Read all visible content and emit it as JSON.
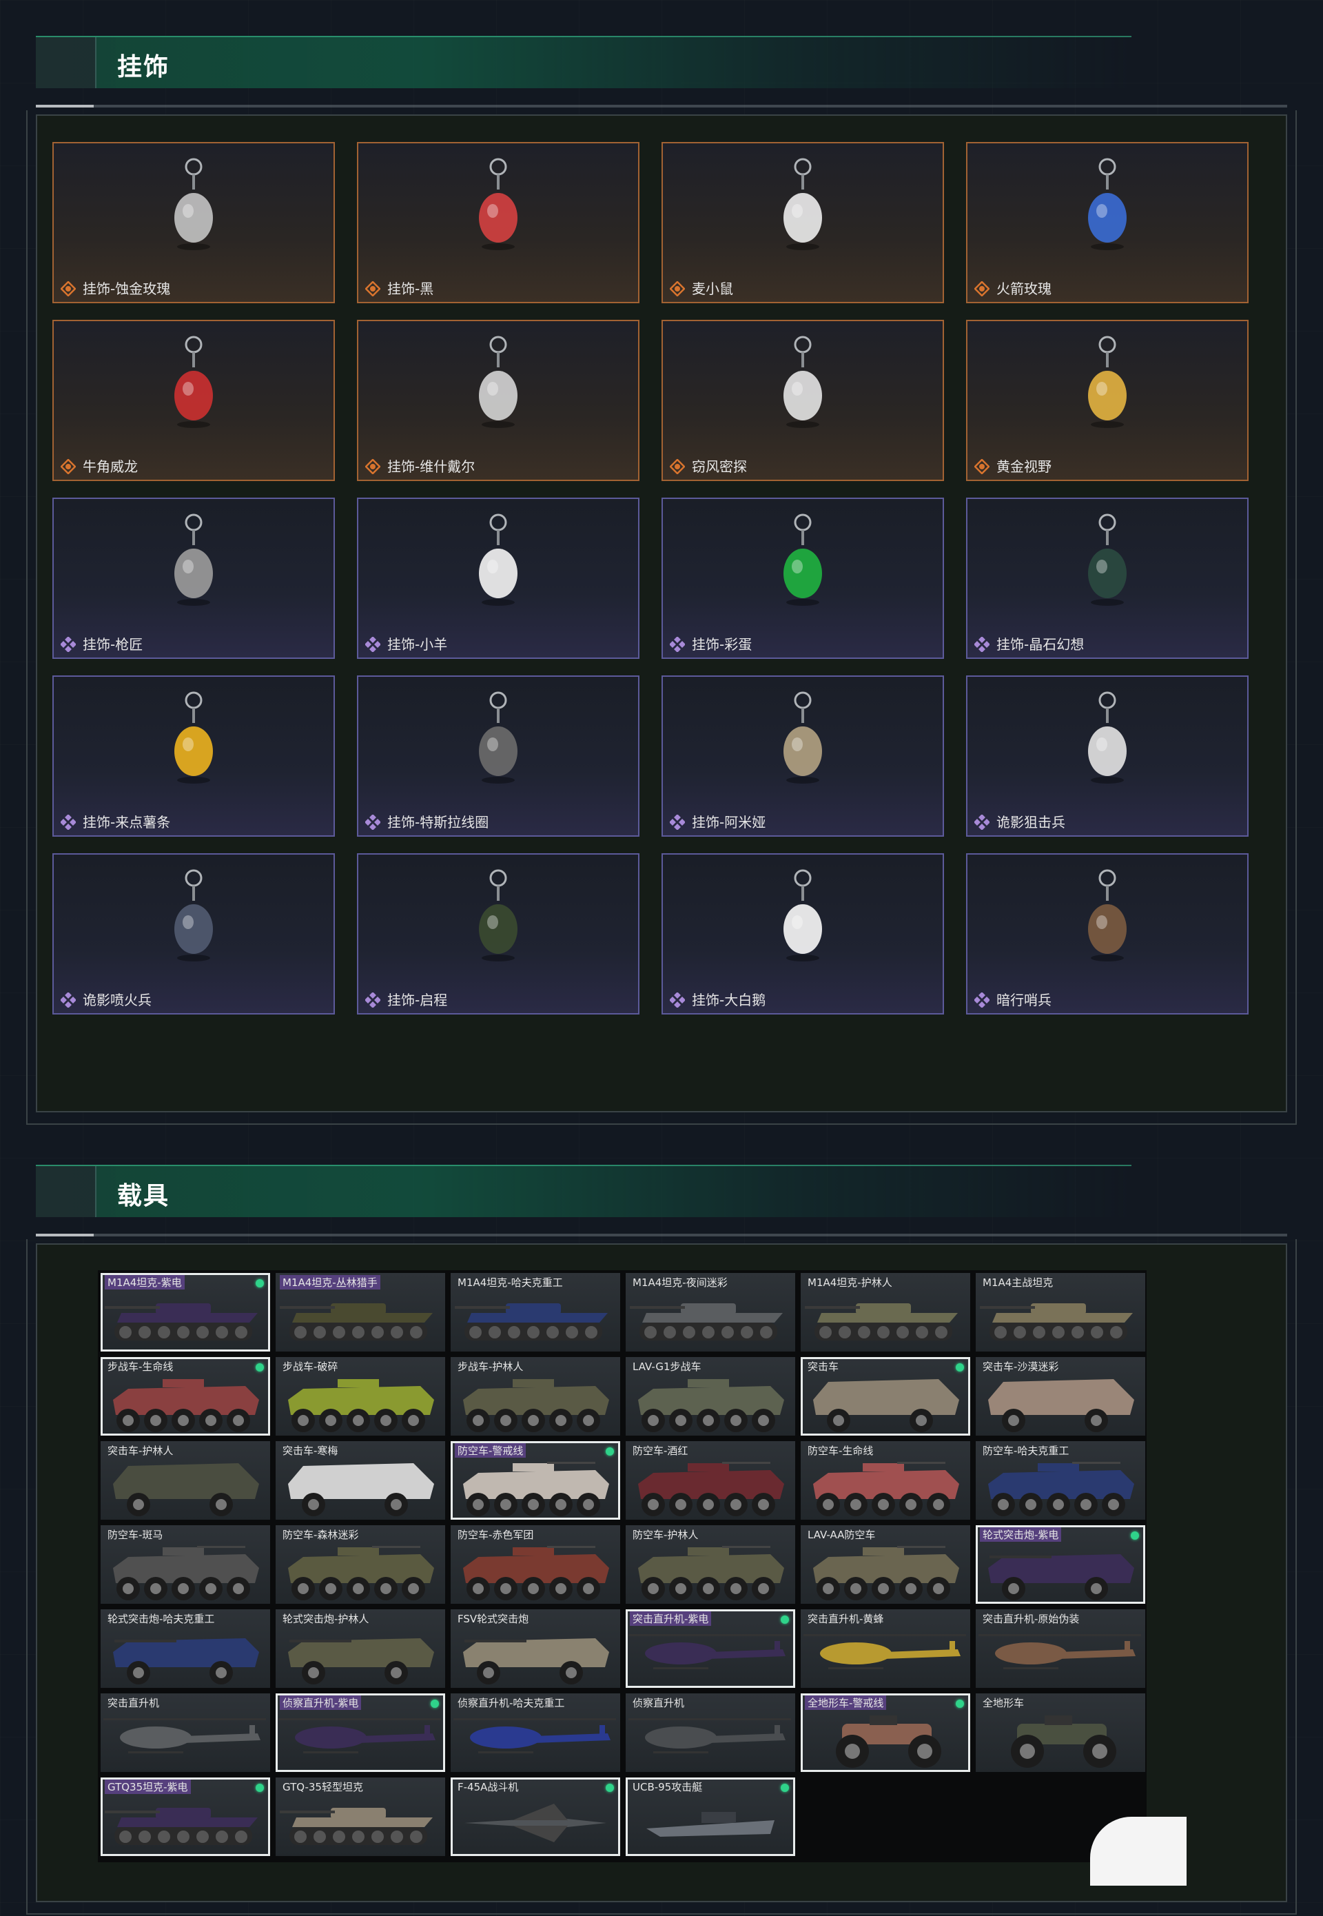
{
  "pendants_section": {
    "title": "挂饰"
  },
  "vehicles_section": {
    "title": "载具"
  },
  "colors": {
    "gold": "#d8742e",
    "purple": "#a88ad8",
    "green_dot": "#2fd38a"
  },
  "pendants": [
    {
      "name": "挂饰-蚀金玫瑰",
      "rarity": "gold",
      "icon": "gold-rose-pendant-icon"
    },
    {
      "name": "挂饰-黑",
      "rarity": "gold",
      "icon": "black-tag-pendant-icon"
    },
    {
      "name": "麦小鼠",
      "rarity": "gold",
      "icon": "mouse-pendant-icon"
    },
    {
      "name": "火箭玫瑰",
      "rarity": "gold",
      "icon": "rocket-rose-pendant-icon"
    },
    {
      "name": "牛角威龙",
      "rarity": "gold",
      "icon": "horn-dragon-pendant-icon"
    },
    {
      "name": "挂饰-维什戴尔",
      "rarity": "gold",
      "icon": "tag-pendant-icon"
    },
    {
      "name": "窃风密探",
      "rarity": "gold",
      "icon": "mouse-spy-pendant-icon"
    },
    {
      "name": "黄金视野",
      "rarity": "gold",
      "icon": "golden-vision-pendant-icon"
    },
    {
      "name": "挂饰-枪匠",
      "rarity": "purple",
      "icon": "gunsmith-pendant-icon"
    },
    {
      "name": "挂饰-小羊",
      "rarity": "purple",
      "icon": "lamb-pendant-icon"
    },
    {
      "name": "挂饰-彩蛋",
      "rarity": "purple",
      "icon": "egg-pendant-icon"
    },
    {
      "name": "挂饰-晶石幻想",
      "rarity": "purple",
      "icon": "crystal-cube-pendant-icon"
    },
    {
      "name": "挂饰-来点薯条",
      "rarity": "purple",
      "icon": "fries-pendant-icon"
    },
    {
      "name": "挂饰-特斯拉线圈",
      "rarity": "purple",
      "icon": "tesla-coil-pendant-icon"
    },
    {
      "name": "挂饰-阿米娅",
      "rarity": "purple",
      "icon": "amiya-pendant-icon"
    },
    {
      "name": "诡影狙击兵",
      "rarity": "purple",
      "icon": "sniper-pendant-icon"
    },
    {
      "name": "诡影喷火兵",
      "rarity": "purple",
      "icon": "flamer-pendant-icon"
    },
    {
      "name": "挂饰-启程",
      "rarity": "purple",
      "icon": "departure-medal-pendant-icon"
    },
    {
      "name": "挂饰-大白鹅",
      "rarity": "purple",
      "icon": "goose-pendant-icon"
    },
    {
      "name": "暗行哨兵",
      "rarity": "purple",
      "icon": "sentinel-pendant-icon"
    }
  ],
  "vehicles": [
    {
      "name": "M1A4坦克-紫电",
      "type": "tank",
      "selected": true,
      "dot": true,
      "purple": true,
      "color": "#3a2d55"
    },
    {
      "name": "M1A4坦克-丛林猎手",
      "type": "tank",
      "selected": false,
      "dot": false,
      "purple": true,
      "color": "#4a4a30"
    },
    {
      "name": "M1A4坦克-哈夫克重工",
      "type": "tank",
      "selected": false,
      "dot": false,
      "purple": false,
      "color": "#2a3a70"
    },
    {
      "name": "M1A4坦克-夜间迷彩",
      "type": "tank",
      "selected": false,
      "dot": false,
      "purple": false,
      "color": "#5a5d60"
    },
    {
      "name": "M1A4坦克-护林人",
      "type": "tank",
      "selected": false,
      "dot": false,
      "purple": false,
      "color": "#6a6a50"
    },
    {
      "name": "M1A4主战坦克",
      "type": "tank",
      "selected": false,
      "dot": false,
      "purple": false,
      "color": "#7a7258"
    },
    {
      "name": "步战车-生命线",
      "type": "ifv",
      "selected": true,
      "dot": true,
      "purple": false,
      "color": "#8a4040"
    },
    {
      "name": "步战车-破碎",
      "type": "ifv",
      "selected": false,
      "dot": false,
      "purple": false,
      "color": "#8a9a30"
    },
    {
      "name": "步战车-护林人",
      "type": "ifv",
      "selected": false,
      "dot": false,
      "purple": false,
      "color": "#5a5a45"
    },
    {
      "name": "LAV-G1步战车",
      "type": "ifv",
      "selected": false,
      "dot": false,
      "purple": false,
      "color": "#5d6250"
    },
    {
      "name": "突击车",
      "type": "mrap",
      "selected": true,
      "dot": true,
      "purple": false,
      "color": "#8a8070"
    },
    {
      "name": "突击车-沙漠迷彩",
      "type": "mrap",
      "selected": false,
      "dot": false,
      "purple": false,
      "color": "#9a8678"
    },
    {
      "name": "突击车-护林人",
      "type": "mrap",
      "selected": false,
      "dot": false,
      "purple": false,
      "color": "#4a4d40"
    },
    {
      "name": "突击车-寒梅",
      "type": "mrap",
      "selected": false,
      "dot": false,
      "purple": false,
      "color": "#d0d0d0"
    },
    {
      "name": "防空车-警戒线",
      "type": "aa",
      "selected": true,
      "dot": true,
      "purple": true,
      "color": "#c0b8b0"
    },
    {
      "name": "防空车-酒红",
      "type": "aa",
      "selected": false,
      "dot": false,
      "purple": false,
      "color": "#6a2a30"
    },
    {
      "name": "防空车-生命线",
      "type": "aa",
      "selected": false,
      "dot": false,
      "purple": false,
      "color": "#a05050"
    },
    {
      "name": "防空车-哈夫克重工",
      "type": "aa",
      "selected": false,
      "dot": false,
      "purple": false,
      "color": "#2a3a70"
    },
    {
      "name": "防空车-斑马",
      "type": "aa",
      "selected": false,
      "dot": false,
      "purple": false,
      "color": "#505050"
    },
    {
      "name": "防空车-森林迷彩",
      "type": "aa",
      "selected": false,
      "dot": false,
      "purple": false,
      "color": "#5a5a40"
    },
    {
      "name": "防空车-赤色军团",
      "type": "aa",
      "selected": false,
      "dot": false,
      "purple": false,
      "color": "#7a3a30"
    },
    {
      "name": "防空车-护林人",
      "type": "aa",
      "selected": false,
      "dot": false,
      "purple": false,
      "color": "#5a5a45"
    },
    {
      "name": "LAV-AA防空车",
      "type": "aa",
      "selected": false,
      "dot": false,
      "purple": false,
      "color": "#6a6550"
    },
    {
      "name": "轮式突击炮-紫电",
      "type": "assault",
      "selected": true,
      "dot": true,
      "purple": true,
      "color": "#3a2d55"
    },
    {
      "name": "轮式突击炮-哈夫克重工",
      "type": "assault",
      "selected": false,
      "dot": false,
      "purple": false,
      "color": "#2a3a70"
    },
    {
      "name": "轮式突击炮-护林人",
      "type": "assault",
      "selected": false,
      "dot": false,
      "purple": false,
      "color": "#5a5a45"
    },
    {
      "name": "FSV轮式突击炮",
      "type": "assault",
      "selected": false,
      "dot": false,
      "purple": false,
      "color": "#8a8270"
    },
    {
      "name": "突击直升机-紫电",
      "type": "heli",
      "selected": true,
      "dot": true,
      "purple": true,
      "color": "#3a2d55"
    },
    {
      "name": "突击直升机-黄蜂",
      "type": "heli",
      "selected": false,
      "dot": false,
      "purple": false,
      "color": "#b89a30"
    },
    {
      "name": "突击直升机-原始伪装",
      "type": "heli",
      "selected": false,
      "dot": false,
      "purple": false,
      "color": "#7a5a45"
    },
    {
      "name": "突击直升机",
      "type": "heli",
      "selected": false,
      "dot": false,
      "purple": false,
      "color": "#5a5d60"
    },
    {
      "name": "侦察直升机-紫电",
      "type": "scout",
      "selected": true,
      "dot": true,
      "purple": true,
      "color": "#3a2d55"
    },
    {
      "name": "侦察直升机-哈夫克重工",
      "type": "scout",
      "selected": false,
      "dot": false,
      "purple": false,
      "color": "#2a3a90"
    },
    {
      "name": "侦察直升机",
      "type": "scout",
      "selected": false,
      "dot": false,
      "purple": false,
      "color": "#4a4d50"
    },
    {
      "name": "全地形车-警戒线",
      "type": "atv",
      "selected": true,
      "dot": true,
      "purple": true,
      "color": "#8a6050"
    },
    {
      "name": "全地形车",
      "type": "atv",
      "selected": false,
      "dot": false,
      "purple": false,
      "color": "#4a5040"
    },
    {
      "name": "GTQ35坦克-紫电",
      "type": "tank",
      "selected": true,
      "dot": true,
      "purple": true,
      "color": "#3a2d55"
    },
    {
      "name": "GTQ-35轻型坦克",
      "type": "tank",
      "selected": false,
      "dot": false,
      "purple": false,
      "color": "#8a8070"
    },
    {
      "name": "F-45A战斗机",
      "type": "jet",
      "selected": true,
      "dot": true,
      "purple": false,
      "color": "#505458"
    },
    {
      "name": "UCB-95攻击艇",
      "type": "boat",
      "selected": true,
      "dot": true,
      "purple": false,
      "color": "#6a7078"
    }
  ]
}
